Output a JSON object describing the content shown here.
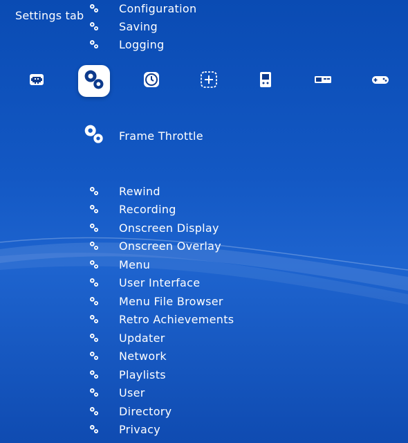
{
  "header": {
    "title": "Settings tab"
  },
  "top_items": [
    {
      "label": "Configuration",
      "icon": "settings-gears-icon"
    },
    {
      "label": "Saving",
      "icon": "settings-gears-icon"
    },
    {
      "label": "Logging",
      "icon": "settings-gears-icon"
    }
  ],
  "tab_bar": [
    {
      "icon": "space-invader-icon",
      "selected": false
    },
    {
      "icon": "settings-gears-icon",
      "selected": true
    },
    {
      "icon": "history-clock-icon",
      "selected": false
    },
    {
      "icon": "add-content-icon",
      "selected": false
    },
    {
      "icon": "handheld-console-icon",
      "selected": false
    },
    {
      "icon": "nes-console-icon",
      "selected": false
    },
    {
      "icon": "gamepad-icon",
      "selected": false
    }
  ],
  "selected_item": {
    "label": "Frame Throttle",
    "icon": "settings-gears-icon"
  },
  "items": [
    {
      "label": "Rewind"
    },
    {
      "label": "Recording"
    },
    {
      "label": "Onscreen Display"
    },
    {
      "label": "Onscreen Overlay"
    },
    {
      "label": "Menu"
    },
    {
      "label": "User Interface"
    },
    {
      "label": "Menu File Browser"
    },
    {
      "label": "Retro Achievements"
    },
    {
      "label": "Updater"
    },
    {
      "label": "Network"
    },
    {
      "label": "Playlists"
    },
    {
      "label": "User"
    },
    {
      "label": "Directory"
    },
    {
      "label": "Privacy"
    }
  ],
  "colors": {
    "background": "#1358c4",
    "text": "#ffffff",
    "selected_tab_bg": "#ffffff",
    "selected_tab_icon": "#0d3a8c"
  }
}
